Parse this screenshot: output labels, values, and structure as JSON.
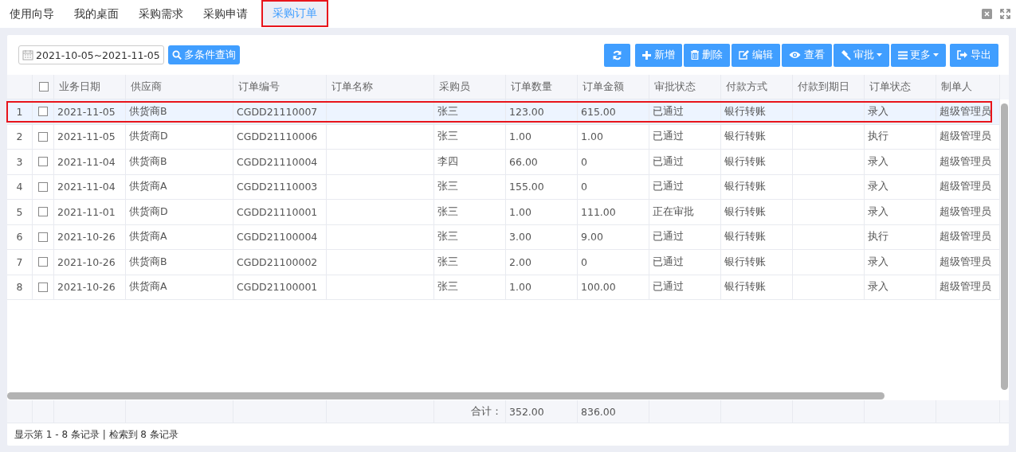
{
  "tabs": [
    {
      "label": "使用向导",
      "selected": false
    },
    {
      "label": "我的桌面",
      "selected": false
    },
    {
      "label": "采购需求",
      "selected": false
    },
    {
      "label": "采购申请",
      "selected": false
    },
    {
      "label": "采购订单",
      "selected": true
    }
  ],
  "toolbar": {
    "date_range": "2021-10-05~2021-11-05",
    "search_button": "多条件查询",
    "buttons": [
      {
        "kind": "refresh",
        "dropdown": false
      },
      {
        "kind": "add",
        "label": "新增",
        "dropdown": false
      },
      {
        "kind": "delete",
        "label": "删除",
        "dropdown": false
      },
      {
        "kind": "edit",
        "label": "编辑",
        "dropdown": false
      },
      {
        "kind": "view",
        "label": "查看",
        "dropdown": false
      },
      {
        "kind": "approve",
        "label": "审批",
        "dropdown": true
      },
      {
        "kind": "more",
        "label": "更多",
        "dropdown": true
      },
      {
        "kind": "export",
        "label": "导出",
        "dropdown": false
      }
    ]
  },
  "table": {
    "header_checked": false,
    "columns": [
      "业务日期",
      "供应商",
      "订单编号",
      "订单名称",
      "采购员",
      "订单数量",
      "订单金额",
      "审批状态",
      "付款方式",
      "付款到期日",
      "订单状态",
      "制单人"
    ],
    "rows": [
      {
        "number": "1",
        "checked": false,
        "selected": true,
        "cells": [
          "2021-11-05",
          "供货商B",
          "CGDD21110007",
          null,
          "张三",
          "123.00",
          "615.00",
          "已通过",
          "银行转账",
          null,
          "录入",
          "超级管理员"
        ]
      },
      {
        "number": "2",
        "checked": false,
        "selected": false,
        "cells": [
          "2021-11-05",
          "供货商D",
          "CGDD21110006",
          null,
          "张三",
          "1.00",
          "1.00",
          "已通过",
          "银行转账",
          null,
          "执行",
          "超级管理员"
        ]
      },
      {
        "number": "3",
        "checked": false,
        "selected": false,
        "cells": [
          "2021-11-04",
          "供货商B",
          "CGDD21110004",
          null,
          "李四",
          "66.00",
          "0",
          "已通过",
          "银行转账",
          null,
          "录入",
          "超级管理员"
        ]
      },
      {
        "number": "4",
        "checked": false,
        "selected": false,
        "cells": [
          "2021-11-04",
          "供货商A",
          "CGDD21110003",
          null,
          "张三",
          "155.00",
          "0",
          "已通过",
          "银行转账",
          null,
          "录入",
          "超级管理员"
        ]
      },
      {
        "number": "5",
        "checked": false,
        "selected": false,
        "cells": [
          "2021-11-01",
          "供货商D",
          "CGDD21110001",
          null,
          "张三",
          "1.00",
          "111.00",
          "正在审批",
          "银行转账",
          null,
          "录入",
          "超级管理员"
        ]
      },
      {
        "number": "6",
        "checked": false,
        "selected": false,
        "cells": [
          "2021-10-26",
          "供货商A",
          "CGDD21100004",
          null,
          "张三",
          "3.00",
          "9.00",
          "已通过",
          "银行转账",
          null,
          "执行",
          "超级管理员"
        ]
      },
      {
        "number": "7",
        "checked": false,
        "selected": false,
        "cells": [
          "2021-10-26",
          "供货商B",
          "CGDD21100002",
          null,
          "张三",
          "2.00",
          "0",
          "已通过",
          "银行转账",
          null,
          "录入",
          "超级管理员"
        ]
      },
      {
        "number": "8",
        "checked": false,
        "selected": false,
        "cells": [
          "2021-10-26",
          "供货商A",
          "CGDD21100001",
          null,
          "张三",
          "1.00",
          "100.00",
          "已通过",
          "银行转账",
          null,
          "录入",
          "超级管理员"
        ]
      }
    ],
    "totals": {
      "label": "合计：",
      "quantity": "352.00",
      "amount": "836.00"
    }
  },
  "status_bar": "显示第 1 - 8 条记录 | 检索到 8 条记录"
}
